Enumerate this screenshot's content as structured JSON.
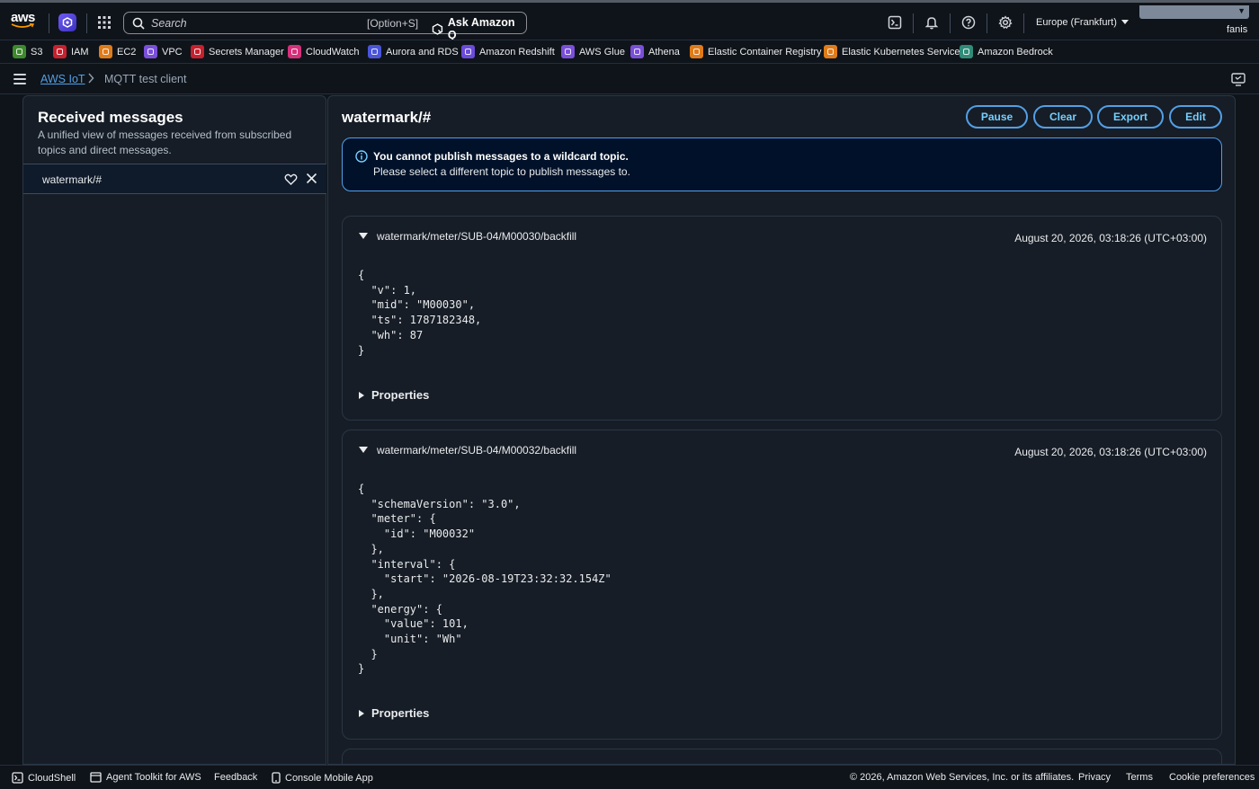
{
  "topnav": {
    "logo_text": "aws",
    "search_placeholder": "Search",
    "search_shortcut": "[Option+S]",
    "ask_q_label": "Ask Amazon Q",
    "region": "Europe (Frankfurt)",
    "account": "fanis"
  },
  "favorites": [
    {
      "label": "S3",
      "color": "#3d8a2c"
    },
    {
      "label": "IAM",
      "color": "#c7202e"
    },
    {
      "label": "EC2",
      "color": "#e07b1a"
    },
    {
      "label": "VPC",
      "color": "#7a4fd9"
    },
    {
      "label": "Secrets Manager",
      "color": "#c7202e"
    },
    {
      "label": "CloudWatch",
      "color": "#d5307a"
    },
    {
      "label": "Aurora and RDS",
      "color": "#4a55d9"
    },
    {
      "label": "Amazon Redshift",
      "color": "#6b4bd9"
    },
    {
      "label": "AWS Glue",
      "color": "#7a4fd9"
    },
    {
      "label": "Athena",
      "color": "#7a4fd9"
    },
    {
      "label": "Elastic Container Registry",
      "color": "#e07b1a"
    },
    {
      "label": "Elastic Kubernetes Service",
      "color": "#e07b1a"
    },
    {
      "label": "Amazon Bedrock",
      "color": "#2f8c78"
    }
  ],
  "breadcrumb": {
    "root": "AWS IoT",
    "current": "MQTT test client"
  },
  "left_panel": {
    "title": "Received messages",
    "description": "A unified view of messages received from subscribed topics and direct messages.",
    "subscription_topic": "watermark/#"
  },
  "right_panel": {
    "title": "watermark/#",
    "buttons": {
      "pause": "Pause",
      "clear": "Clear",
      "export": "Export",
      "edit": "Edit"
    },
    "alert": {
      "title": "You cannot publish messages to a wildcard topic.",
      "body": "Please select a different topic to publish messages to."
    },
    "messages": [
      {
        "topic": "watermark/meter/SUB-04/M00030/backfill",
        "timestamp": "August 20, 2026, 03:18:26 (UTC+03:00)",
        "payload": "{\n  \"v\": 1,\n  \"mid\": \"M00030\",\n  \"ts\": 1787182348,\n  \"wh\": 87\n}",
        "properties_label": "Properties"
      },
      {
        "topic": "watermark/meter/SUB-04/M00032/backfill",
        "timestamp": "August 20, 2026, 03:18:26 (UTC+03:00)",
        "payload": "{\n  \"schemaVersion\": \"3.0\",\n  \"meter\": {\n    \"id\": \"M00032\"\n  },\n  \"interval\": {\n    \"start\": \"2026-08-19T23:32:32.154Z\"\n  },\n  \"energy\": {\n    \"value\": 101,\n    \"unit\": \"Wh\"\n  }\n}",
        "properties_label": "Properties"
      }
    ]
  },
  "footer": {
    "cloudshell": "CloudShell",
    "agent_toolkit": "Agent Toolkit for AWS",
    "feedback": "Feedback",
    "mobile_app": "Console Mobile App",
    "copyright": "© 2026, Amazon Web Services, Inc. or its affiliates.",
    "privacy": "Privacy",
    "terms": "Terms",
    "cookies": "Cookie preferences"
  }
}
